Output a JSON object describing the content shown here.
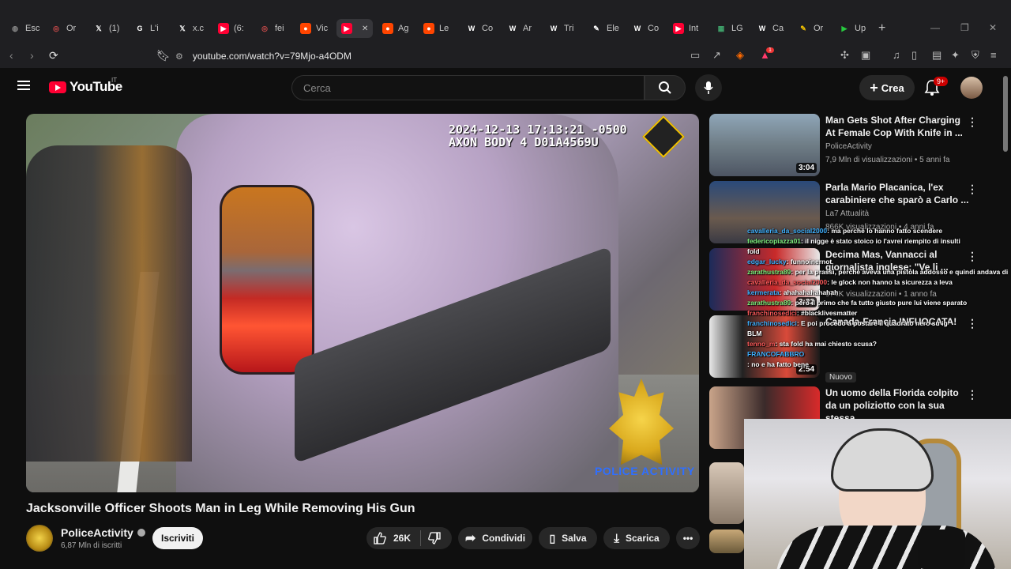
{
  "browser": {
    "tabs": [
      {
        "label": "Esc",
        "icon": "globe-icon",
        "color": "#8a8a8a"
      },
      {
        "label": "Or",
        "icon": "target-icon",
        "color": "#c94a4a"
      },
      {
        "label": "(1)",
        "icon": "x-icon",
        "color": "#ffffff"
      },
      {
        "label": "L'i",
        "icon": "google-icon",
        "color": "#ffffff"
      },
      {
        "label": "x.c",
        "icon": "x-icon",
        "color": "#ffffff"
      },
      {
        "label": "(6:",
        "icon": "youtube-icon",
        "color": "#ff0033"
      },
      {
        "label": "fei",
        "icon": "target-icon",
        "color": "#c94a4a"
      },
      {
        "label": "Vic",
        "icon": "reddit-icon",
        "color": "#ff4500"
      },
      {
        "label": "",
        "icon": "youtube-icon",
        "color": "#ff0033"
      },
      {
        "label": "Ag",
        "icon": "reddit-icon",
        "color": "#ff4500"
      },
      {
        "label": "Le",
        "icon": "reddit-icon",
        "color": "#ff4500"
      },
      {
        "label": "Co",
        "icon": "wikipedia-icon",
        "color": "#ffffff"
      },
      {
        "label": "Ar",
        "icon": "wikipedia-icon",
        "color": "#ffffff"
      },
      {
        "label": "Tri",
        "icon": "wikipedia-icon",
        "color": "#ffffff"
      },
      {
        "label": "Ele",
        "icon": "document-icon",
        "color": "#ffffff"
      },
      {
        "label": "Co",
        "icon": "wikipedia-icon",
        "color": "#ffffff"
      },
      {
        "label": "Int",
        "icon": "youtube-icon",
        "color": "#ff0033"
      },
      {
        "label": "LG",
        "icon": "sheet-icon",
        "color": "#3fa36b"
      },
      {
        "label": "Ca",
        "icon": "wikipedia-icon",
        "color": "#ffffff"
      },
      {
        "label": "Or",
        "icon": "document-icon",
        "color": "#f2c200"
      },
      {
        "label": "Up",
        "icon": "play-icon",
        "color": "#27c93f"
      }
    ],
    "new_tab": "+",
    "url": "youtube.com/watch?v=79Mjo-a4ODM",
    "extension_badge": "1"
  },
  "youtube": {
    "logo_text": "YouTube",
    "country": "IT",
    "search_placeholder": "Cerca",
    "crea_label": "Crea",
    "notification_count": "9+"
  },
  "video": {
    "overlay_timestamp": "2024-12-13 17:13:21 -0500",
    "overlay_device": "AXON BODY 4 D01A4569U",
    "watermark": "POLICE ACTIVITY",
    "title": "Jacksonville Officer Shoots Man in Leg While Removing His Gun",
    "channel": "PoliceActivity",
    "subscribers": "6,87 Mln di iscritti",
    "subscribe_label": "Iscriviti",
    "likes": "26K",
    "share_label": "Condividi",
    "save_label": "Salva",
    "download_label": "Scarica"
  },
  "recommendations": [
    {
      "title": "Man Gets Shot After Charging At Female Cop With Knife in ...",
      "channel": "PoliceActivity",
      "meta": "7,9 Mln di visualizzazioni • 5 anni fa",
      "duration": "3:04"
    },
    {
      "title": "Parla Mario Placanica, l'ex carabiniere che sparò a Carlo ...",
      "channel": "La7 Attualità",
      "meta": "866K visualizzazioni • 4 anni fa",
      "duration": ""
    },
    {
      "title": "Decima Mas, Vannacci al giornalista inglese: \"Ve li ...",
      "channel": "",
      "meta": "974K visualizzazioni • 1 anno fa",
      "duration": "3:22"
    },
    {
      "title": "Canada-Francia INFUOCATA!",
      "channel": "",
      "meta": "",
      "duration": "2:54"
    },
    {
      "title": "Un uomo della Florida colpito da un poliziotto con la sua stessa...",
      "channel": "",
      "meta": "Nuovo",
      "duration": ""
    }
  ],
  "chat": [
    {
      "user": "cavalleria_da_social2000",
      "text": ": ma perchè lo hanno fatto scendere"
    },
    {
      "user": "federicopiazza01",
      "text": ": il nigge è stato stoico io l'avrei riempito di insulti"
    },
    {
      "user": "",
      "text": "fold"
    },
    {
      "user": "edgar_lucky",
      "text": ": funnoinernot"
    },
    {
      "user": "zarathustra89",
      "text": ": per la prassi, perché aveva una pistola addosso e quindi andava disarmato"
    },
    {
      "user": "cavalleria_da_social2000",
      "text": ": le glock non hanno la sicurezza a leva"
    },
    {
      "user": "kermerata",
      "text": ": ahahahahahahah"
    },
    {
      "user": "zarathustra89",
      "text": ": però il primo che fa tutto giusto pure lui viene sparato"
    },
    {
      "user": "franchinosedici",
      "text": ": #blacklivesmatter"
    },
    {
      "user": "franchinosedici",
      "text": ": E poi procedo a postare il quadrato nero su ig"
    },
    {
      "user": "",
      "text": "BLM"
    },
    {
      "user": "tenno_m",
      "text": ": sta fold ha mai chiesto scusa?"
    },
    {
      "user": "FRANCOFABBRO",
      "text": ""
    },
    {
      "user": "",
      "text": ": no e ha fatto bene"
    }
  ]
}
